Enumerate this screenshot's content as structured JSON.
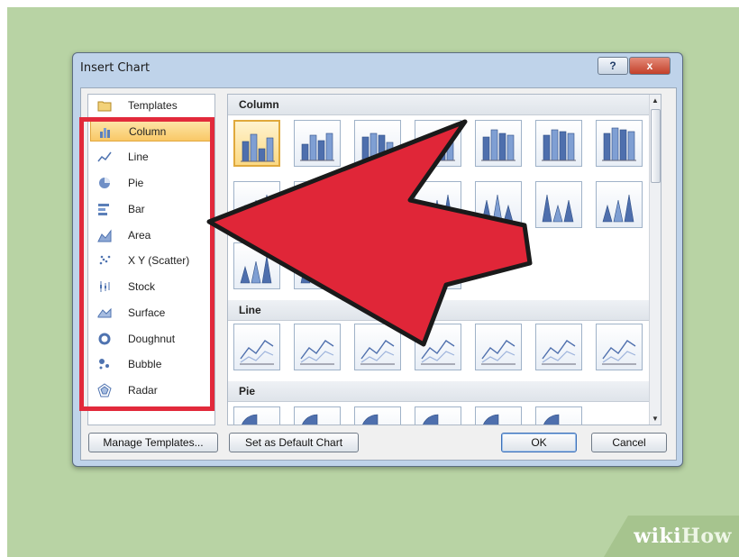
{
  "dialog": {
    "title": "Insert Chart",
    "help_label": "?",
    "close_label": "x"
  },
  "chart_types": [
    {
      "label": "Templates",
      "icon": "folder-icon",
      "selected": false
    },
    {
      "label": "Column",
      "icon": "column-chart-icon",
      "selected": true
    },
    {
      "label": "Line",
      "icon": "line-chart-icon",
      "selected": false
    },
    {
      "label": "Pie",
      "icon": "pie-chart-icon",
      "selected": false
    },
    {
      "label": "Bar",
      "icon": "bar-chart-icon",
      "selected": false
    },
    {
      "label": "Area",
      "icon": "area-chart-icon",
      "selected": false
    },
    {
      "label": "X Y (Scatter)",
      "icon": "scatter-chart-icon",
      "selected": false
    },
    {
      "label": "Stock",
      "icon": "stock-chart-icon",
      "selected": false
    },
    {
      "label": "Surface",
      "icon": "surface-chart-icon",
      "selected": false
    },
    {
      "label": "Doughnut",
      "icon": "doughnut-chart-icon",
      "selected": false
    },
    {
      "label": "Bubble",
      "icon": "bubble-chart-icon",
      "selected": false
    },
    {
      "label": "Radar",
      "icon": "radar-chart-icon",
      "selected": false
    }
  ],
  "gallery": {
    "sections": [
      {
        "label": "Column"
      },
      {
        "label": "Line"
      },
      {
        "label": "Pie"
      }
    ]
  },
  "buttons": {
    "manage_templates": "Manage Templates...",
    "set_default": "Set as Default Chart",
    "ok": "OK",
    "cancel": "Cancel"
  },
  "watermark": {
    "wiki": "wiki",
    "how": "How"
  },
  "colors": {
    "background": "#b8d3a4",
    "highlight": "#e22a3b",
    "arrow": "#e02638",
    "selection": "#f9c866"
  }
}
